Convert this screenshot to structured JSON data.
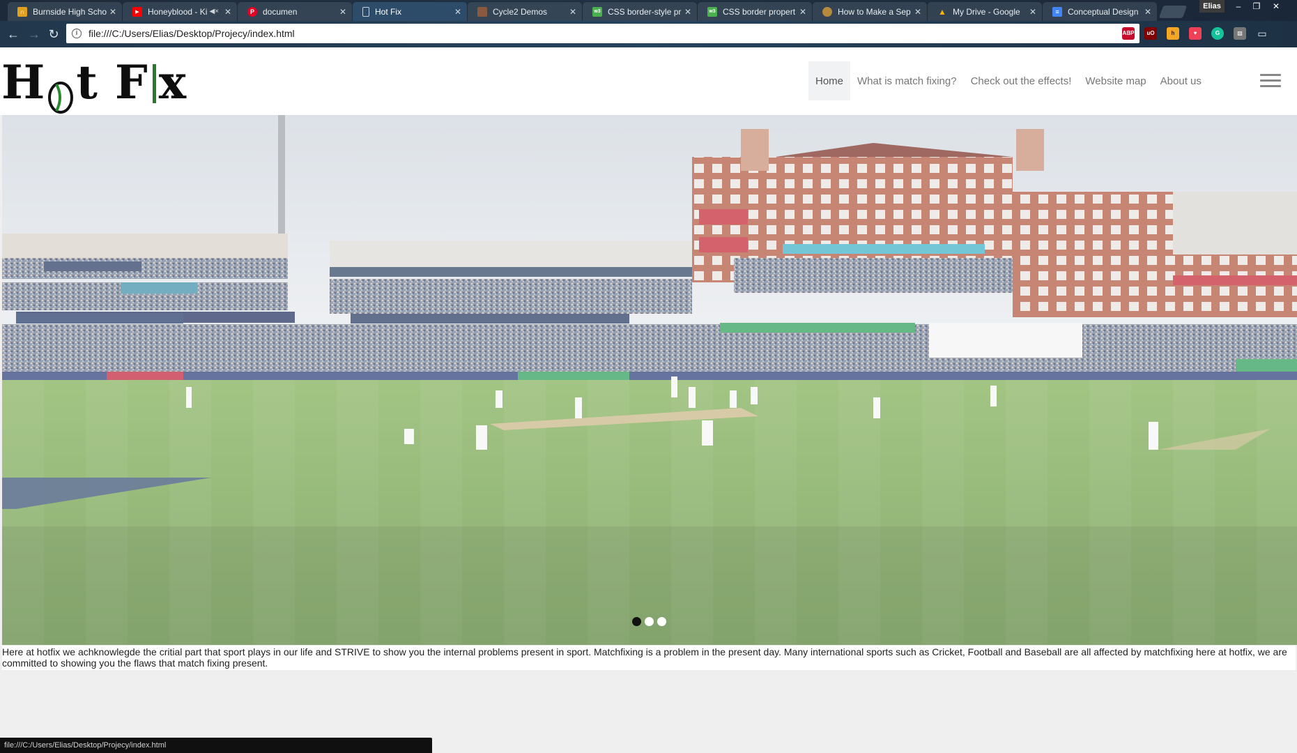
{
  "browser": {
    "tabs": [
      {
        "title": "Burnside High Scho",
        "favicon_color": "#e0a020",
        "favicon_glyph": "∩∩",
        "active": false
      },
      {
        "title": "Honeyblood - Ki",
        "favicon_color": "#ff0000",
        "favicon_glyph": "▶",
        "active": false,
        "muted": true
      },
      {
        "title": "documen",
        "favicon_color": "#e60023",
        "favicon_glyph": "P",
        "active": false
      },
      {
        "title": "Hot Fix",
        "favicon_color": "#9aa7b3",
        "favicon_glyph": "",
        "active": true
      },
      {
        "title": "Cycle2 Demos",
        "favicon_color": "#8a5a40",
        "favicon_glyph": "",
        "active": false
      },
      {
        "title": "CSS border-style pr",
        "favicon_color": "#4caf50",
        "favicon_glyph": "w3",
        "active": false
      },
      {
        "title": "CSS border propert",
        "favicon_color": "#4caf50",
        "favicon_glyph": "w3",
        "active": false
      },
      {
        "title": "How to Make a Sep",
        "favicon_color": "#b58a3a",
        "favicon_glyph": "",
        "active": false
      },
      {
        "title": "My Drive - Google",
        "favicon_color": "#f4b400",
        "favicon_glyph": "▲",
        "active": false
      },
      {
        "title": "Conceptual Design",
        "favicon_color": "#4285f4",
        "favicon_glyph": "≡",
        "active": false
      }
    ],
    "user_name": "Elias",
    "url": "file:///C:/Users/Elias/Desktop/Projecy/index.html",
    "status_url": "file:///C:/Users/Elias/Desktop/Projecy/index.html",
    "extensions": [
      {
        "name": "adblock-plus-icon",
        "label": "ABP",
        "color": "#c70d2c"
      },
      {
        "name": "ublock-icon",
        "label": "uO",
        "color": "#800000"
      },
      {
        "name": "honey-icon",
        "label": "h",
        "color": "#f5a623"
      },
      {
        "name": "pocket-icon",
        "label": "♥",
        "color": "#ef4056"
      },
      {
        "name": "grammarly-icon",
        "label": "G",
        "color": "#15c39a"
      },
      {
        "name": "extension-gray-icon",
        "label": "▧",
        "color": "#777777"
      },
      {
        "name": "chat-icon",
        "label": "▭",
        "color": "#555555"
      }
    ]
  },
  "site": {
    "logo_text_1": "H",
    "logo_text_2": "t F",
    "logo_text_3": "x",
    "nav": [
      {
        "label": "Home",
        "active": true
      },
      {
        "label": "What is match fixing?",
        "active": false
      },
      {
        "label": "Check out the effects!",
        "active": false
      },
      {
        "label": "Website map",
        "active": false
      },
      {
        "label": "About us",
        "active": false
      }
    ],
    "slider_dots": 3,
    "slider_active": 0,
    "intro_text": "Here at hotfix we achknowlegde the critial part that sport plays in our life and STRIVE to show you the internal problems present in sport. Matchfixing is a problem in the present day. Many international sports such as Cricket, Football and Baseball are all affected by matchfixing here at hotfix, we are committed to showing you the flaws that match fixing present."
  }
}
